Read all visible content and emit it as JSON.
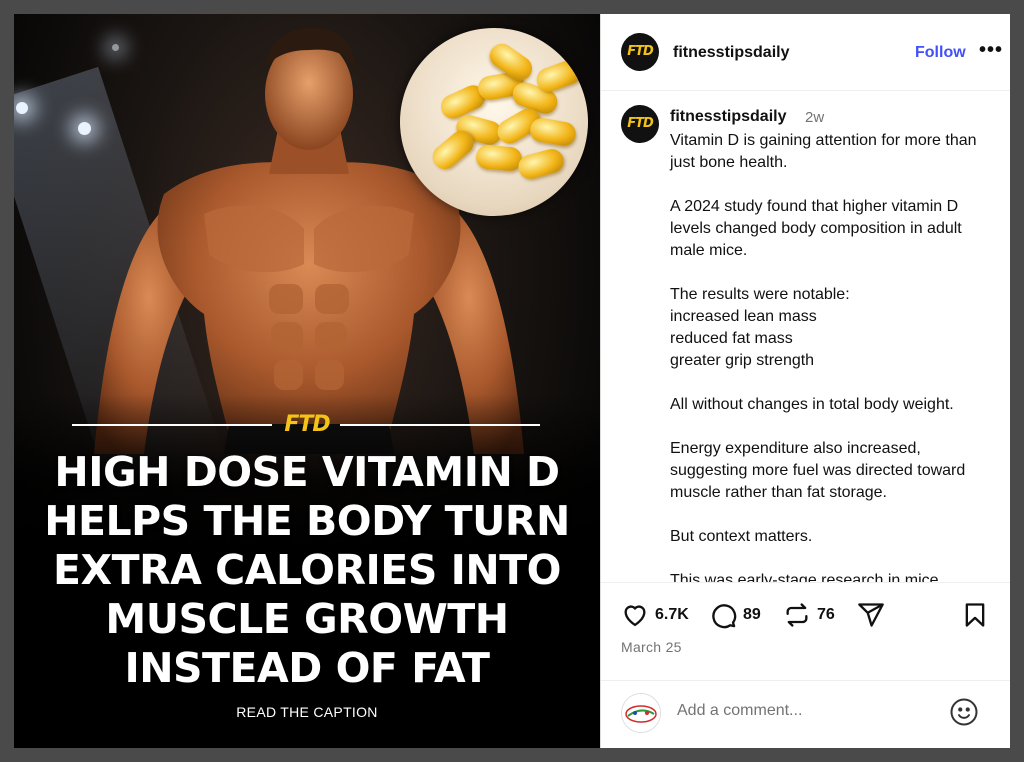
{
  "post": {
    "image": {
      "logo_text": "FTD",
      "headline_lines": [
        "HIGH DOSE VITAMIN D",
        "HELPS THE BODY TURN",
        "EXTRA CALORIES INTO",
        "MUSCLE GROWTH",
        "INSTEAD OF FAT"
      ],
      "footer": "READ THE CAPTION"
    },
    "header": {
      "avatar_text": "FTD",
      "username": "fitnesstipsdaily",
      "follow_label": "Follow",
      "more_label": "•••"
    },
    "caption": {
      "username": "fitnesstipsdaily",
      "time": "2w",
      "paragraphs": [
        "Vitamin D is gaining attention for more than just bone health.",
        "A 2024 study found that higher vitamin D levels changed body composition in adult male mice.",
        "The results were notable:\nincreased lean mass\nreduced fat mass\ngreater grip strength",
        "All without changes in total body weight.",
        "Energy expenditure also increased, suggesting more fuel was directed toward muscle rather than fat storage.",
        "But context matters.",
        "This was early-stage research in mice"
      ]
    },
    "actions": {
      "likes": "6.7K",
      "comments": "89",
      "reposts": "76",
      "date": "March 25"
    },
    "comment": {
      "placeholder": "Add a comment..."
    }
  },
  "colors": {
    "accent": "#4150f7",
    "brand_gold": "#f3c417",
    "muted": "#737373"
  },
  "icons": [
    "heart-icon",
    "comment-icon",
    "repost-icon",
    "share-icon",
    "bookmark-icon",
    "emoji-icon",
    "more-icon"
  ]
}
